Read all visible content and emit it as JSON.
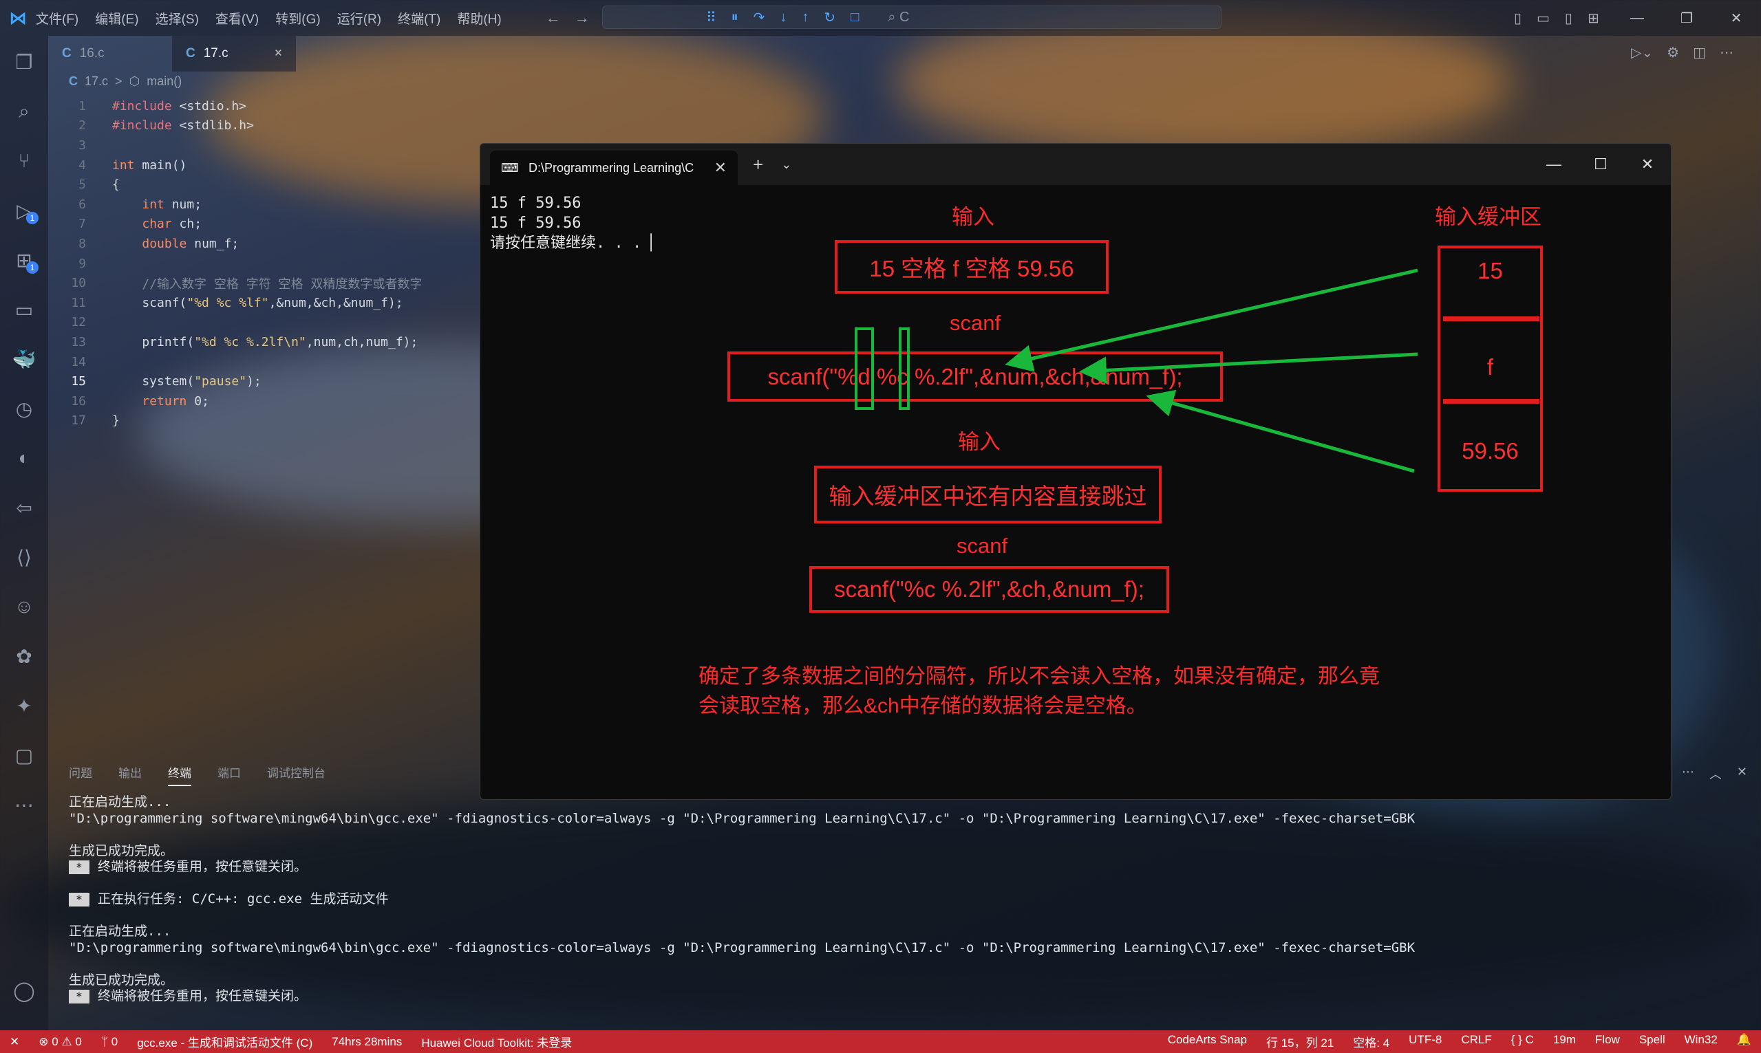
{
  "menu": [
    "文件(F)",
    "编辑(E)",
    "选择(S)",
    "查看(V)",
    "转到(G)",
    "运行(R)",
    "终端(T)",
    "帮助(H)"
  ],
  "search_placeholder": "C",
  "tabs": [
    {
      "lang": "C",
      "name": "16.c"
    },
    {
      "lang": "C",
      "name": "17.c",
      "close": "×"
    }
  ],
  "breadcrumb": {
    "lang": "C",
    "file": "17.c",
    "sep": ">",
    "symbol": "main()"
  },
  "code": [
    {
      "n": "1",
      "text": "#include <stdio.h>"
    },
    {
      "n": "2",
      "text": "#include <stdlib.h>"
    },
    {
      "n": "3",
      "text": ""
    },
    {
      "n": "4",
      "text": "int main()"
    },
    {
      "n": "5",
      "text": "{"
    },
    {
      "n": "6",
      "text": "    int num;"
    },
    {
      "n": "7",
      "text": "    char ch;"
    },
    {
      "n": "8",
      "text": "    double num_f;"
    },
    {
      "n": "9",
      "text": ""
    },
    {
      "n": "10",
      "text": "    //输入数字 空格 字符 空格 双精度数字或者数字"
    },
    {
      "n": "11",
      "text": "    scanf(\"%d %c %lf\",&num,&ch,&num_f);"
    },
    {
      "n": "12",
      "text": ""
    },
    {
      "n": "13",
      "text": "    printf(\"%d %c %.2lf\\n\",num,ch,num_f);"
    },
    {
      "n": "14",
      "text": ""
    },
    {
      "n": "15",
      "text": "    system(\"pause\");"
    },
    {
      "n": "16",
      "text": "    return 0;"
    },
    {
      "n": "17",
      "text": "}"
    }
  ],
  "terminal": {
    "tab_title": "D:\\Programmering Learning\\C",
    "lines": [
      "15 f 59.56",
      "15 f 59.56",
      "请按任意键继续. . . "
    ]
  },
  "annotations": {
    "input_label_1": "输入",
    "input_value": "15 空格 f 空格 59.56",
    "scanf_label_1": "scanf",
    "scanf_call_1": "scanf(\"%d %c %.2lf\",&num,&ch,&num_f);",
    "input_label_2": "输入",
    "skip_text": "输入缓冲区中还有内容直接跳过",
    "scanf_label_2": "scanf",
    "scanf_call_2": "scanf(\"%c %.2lf\",&ch,&num_f);",
    "buffer_title": "输入缓冲区",
    "buffer_cells": [
      "15",
      "f",
      "59.56"
    ],
    "note": "确定了多条数据之间的分隔符，所以不会读入空格，如果没有确定，那么竟会读取空格，那么&ch中存储的数据将会是空格。"
  },
  "panel": {
    "tabs": [
      "问题",
      "输出",
      "终端",
      "端口",
      "调试控制台"
    ],
    "active_tab": "终端",
    "lines": [
      "正在启动生成...",
      "\"D:\\programmering software\\mingw64\\bin\\gcc.exe\" -fdiagnostics-color=always -g \"D:\\Programmering Learning\\C\\17.c\" -o \"D:\\Programmering Learning\\C\\17.exe\" -fexec-charset=GBK",
      "",
      "生成已成功完成。",
      "终端将被任务重用，按任意键关闭。",
      "",
      "正在执行任务: C/C++: gcc.exe 生成活动文件",
      "",
      "正在启动生成...",
      "\"D:\\programmering software\\mingw64\\bin\\gcc.exe\" -fdiagnostics-color=always -g \"D:\\Programmering Learning\\C\\17.c\" -o \"D:\\Programmering Learning\\C\\17.exe\" -fexec-charset=GBK",
      "",
      "生成已成功完成。",
      "终端将被任务重用，按任意键关闭。"
    ]
  },
  "statusbar": {
    "left": [
      "⊗ 0 ⚠ 0",
      "ᛘ 0",
      "gcc.exe - 生成和调试活动文件 (C)",
      "74hrs 28mins",
      "Huawei Cloud Toolkit: 未登录"
    ],
    "right": [
      "CodeArts Snap",
      "行 15，列 21",
      "空格: 4",
      "UTF-8",
      "CRLF",
      "{ } C",
      "19m",
      "Flow",
      "Spell",
      "Win32"
    ]
  },
  "colors": {
    "annotation_red": "#e11d1d",
    "annotation_green": "#19b83a",
    "statusbar": "#c1272d"
  }
}
